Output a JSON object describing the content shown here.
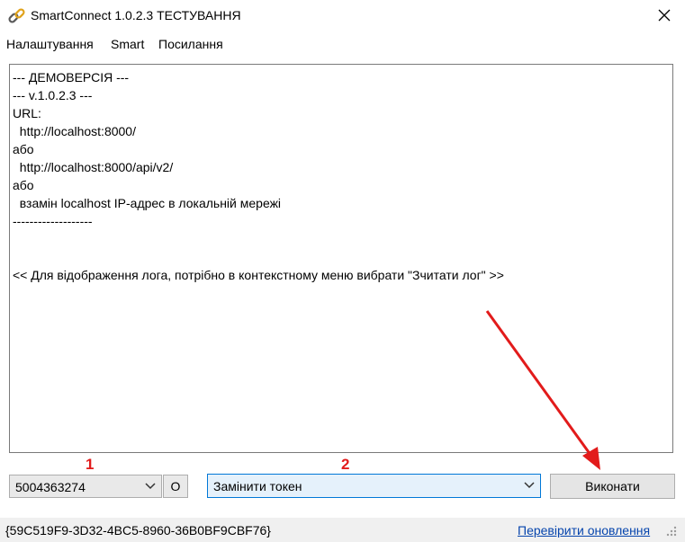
{
  "window": {
    "title": "SmartConnect 1.0.2.3 ТЕСТУВАННЯ",
    "icon": "link-icon"
  },
  "menu": [
    "Налаштування",
    "Smart",
    "Посилання"
  ],
  "log_lines": [
    "--- ДЕМОВЕРСІЯ ---",
    "--- v.1.0.2.3 ---",
    "URL:",
    "  http://localhost:8000/",
    "або",
    "  http://localhost:8000/api/v2/",
    "або",
    "  взамін localhost IP-адрес в локальній мережі",
    "-------------------",
    "",
    "",
    "<< Для відображення лога, потрібно в контекстному меню вибрати \"Зчитати лог\" >>"
  ],
  "controls": {
    "device_select": {
      "value": "5004363274"
    },
    "o_button": "O",
    "action_select": {
      "value": "Замінити токен"
    },
    "execute_button": "Виконати"
  },
  "annotations": {
    "marker1": "1",
    "marker2": "2",
    "color": "#e21b1b"
  },
  "status": {
    "guid": "{59C519F9-3D32-4BC5-8960-36B0BF9CBF76}",
    "update_link": "Перевірити оновлення"
  }
}
